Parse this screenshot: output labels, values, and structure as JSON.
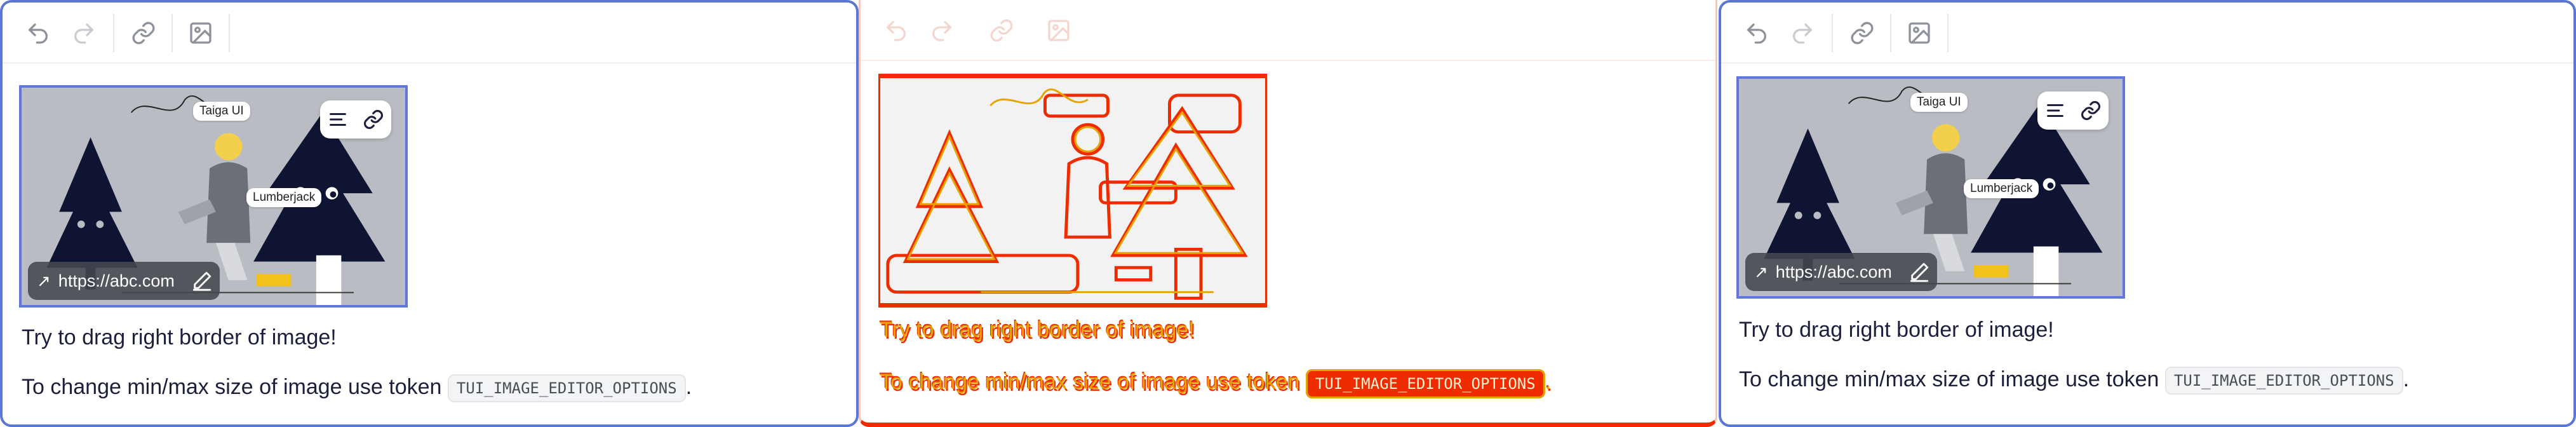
{
  "toolbar": {
    "buttons": [
      {
        "icon": "undo-icon"
      },
      {
        "icon": "redo-icon"
      },
      {
        "icon": "link-icon"
      },
      {
        "icon": "image-icon"
      }
    ]
  },
  "image": {
    "callouts": {
      "taiga": "Taiga UI",
      "lumberjack": "Lumberjack"
    },
    "link_url": "https://abc.com",
    "tools": [
      "align-icon",
      "link-icon"
    ],
    "arrow_glyph": "↗"
  },
  "text": {
    "line1": "Try to drag right border of image!",
    "line2_prefix": "To change min/max size of image use token",
    "token": "TUI_IMAGE_EDITOR_OPTIONS",
    "line2_suffix": "."
  },
  "colors": {
    "panel_border": "#5b76d3",
    "diff_red": "#ef2b00",
    "diff_yellow": "#e7a300",
    "illustration_bg": "#b9bcc2",
    "tree_dark": "#0f1433"
  }
}
